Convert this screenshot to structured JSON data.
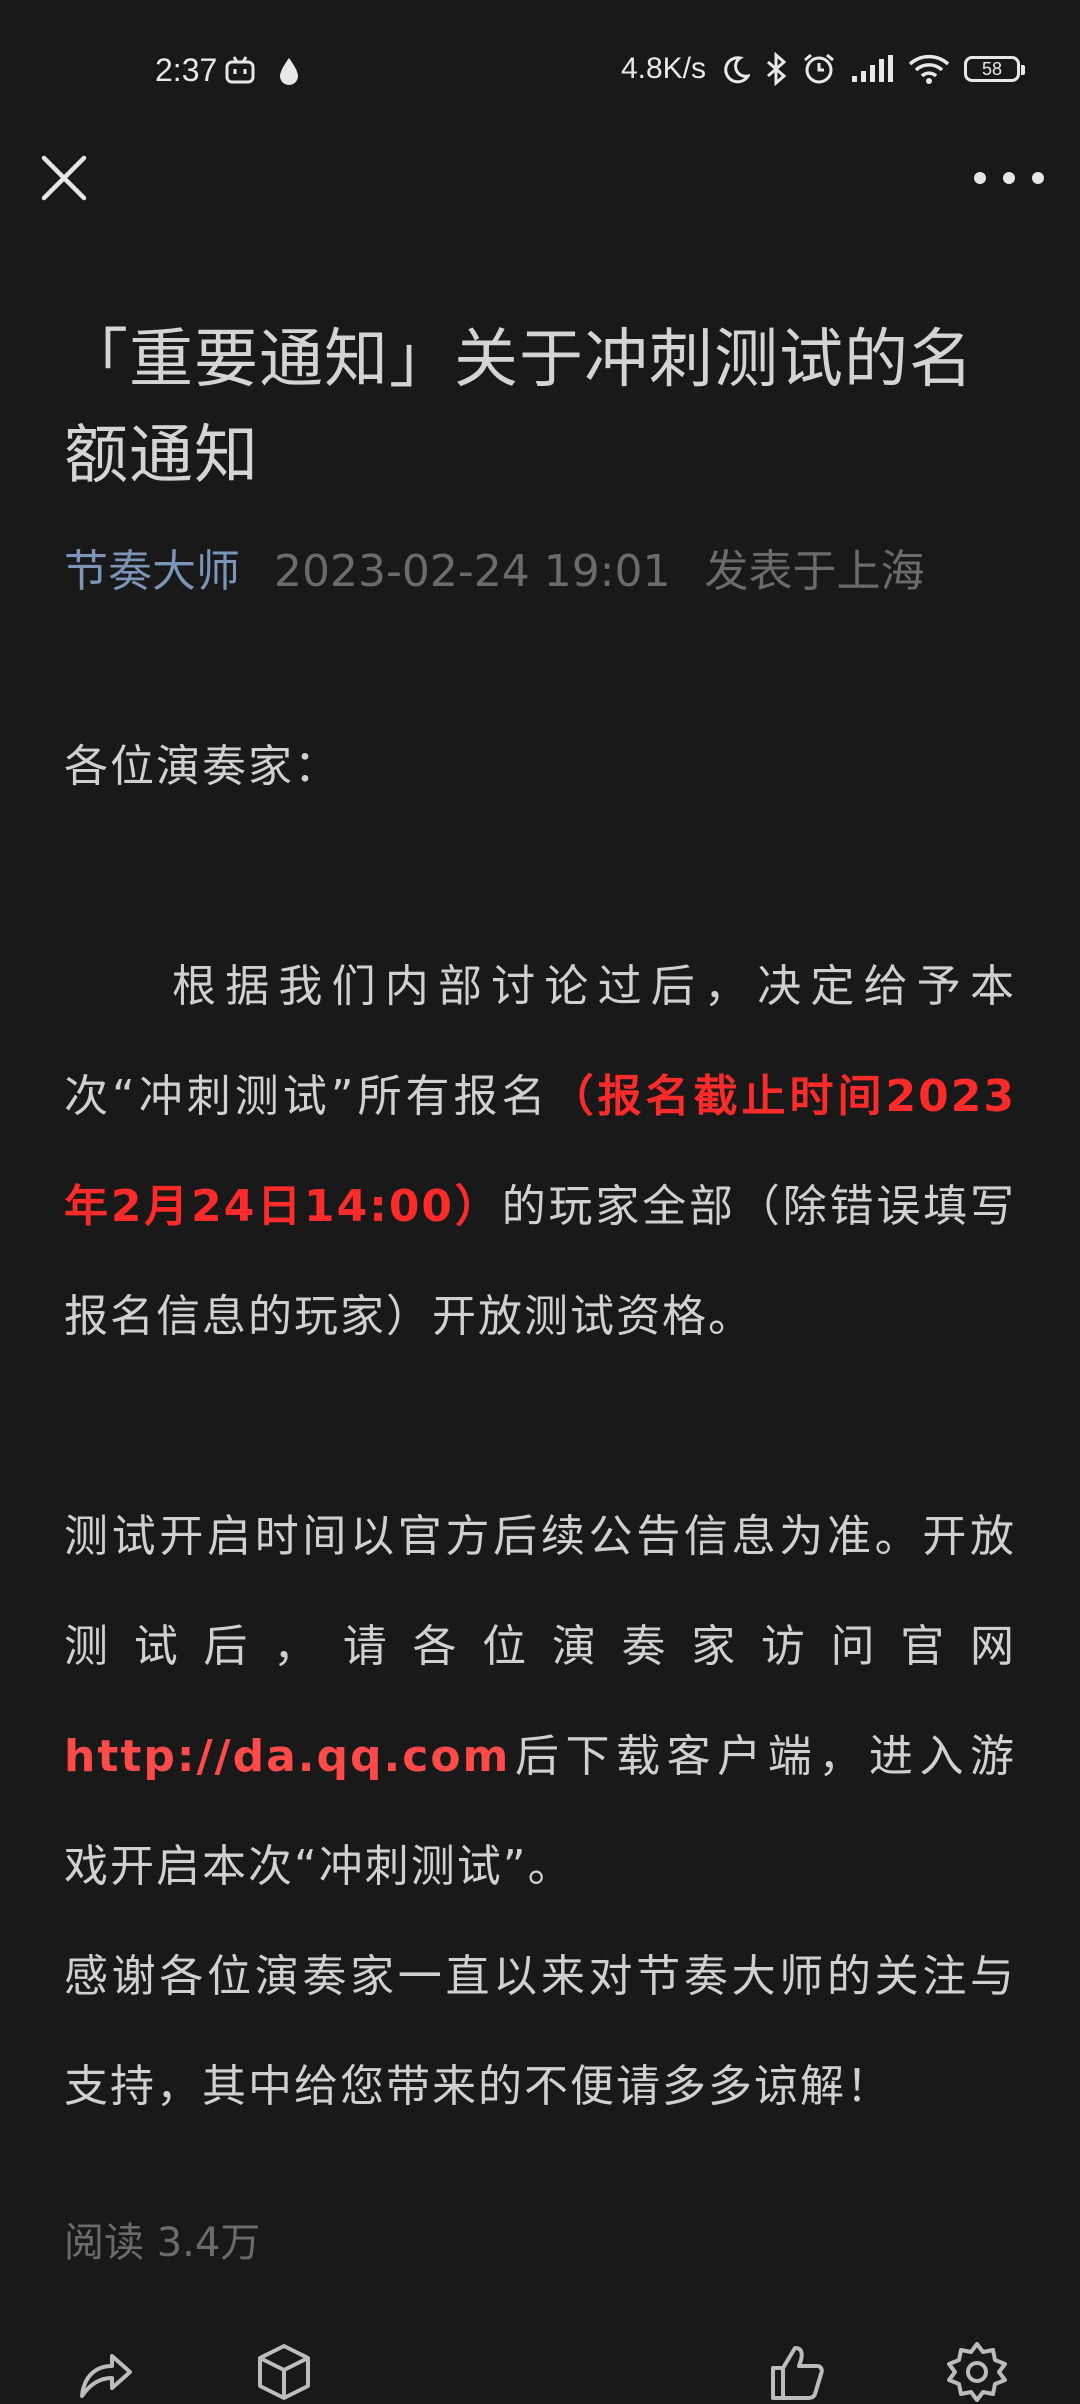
{
  "status_bar": {
    "time": "2:37",
    "network_speed": "4.8K/s",
    "battery_level": "58",
    "icons": [
      "bilibili-icon",
      "drop-icon",
      "moon-icon",
      "bluetooth-icon",
      "alarm-icon",
      "signal-icon",
      "wifi-icon",
      "battery-icon"
    ]
  },
  "nav": {
    "close_icon": "close-icon",
    "more_icon": "more-icon"
  },
  "article": {
    "title": "「重要通知」关于冲刺测试的名额通知",
    "author": "节奏大师",
    "date": "2023-02-24 19:01",
    "location": "发表于上海",
    "greeting": "各位演奏家：",
    "p1_a": "根据我们内部讨论过后，决定给予本次“冲刺测试”所有报名",
    "p1_highlight": "（报名截止时间2023年2月24日14:00）",
    "p1_b": "的玩家全部（除错误填写报名信息的玩家）开放测试资格。",
    "p2_a": "测试开启时间以官方后续公告信息为准。开放测试后，请各位演奏家访问官网",
    "p2_link": "http://da.qq.com",
    "p2_b": "后下载客户端，进入游戏开启本次“冲刺测试”。",
    "p3": "感谢各位演奏家一直以来对节奏大师的关注与支持，其中给您带来的不便请多多谅解！",
    "reads": "阅读 3.4万"
  },
  "bottom_bar": {
    "icons": [
      "share-icon",
      "box-icon",
      "like-icon",
      "settings-icon"
    ]
  },
  "colors": {
    "background": "#191919",
    "author": "#7b95b8",
    "highlight": "#ff2a2a",
    "meta": "#6b6b6b"
  }
}
